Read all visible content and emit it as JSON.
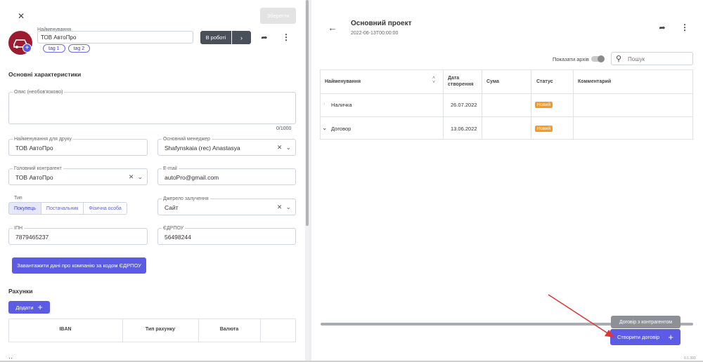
{
  "left": {
    "save_label": "Зберегти",
    "name_label": "Найменування",
    "name_value": "ТОВ АвтоПро",
    "status_label": "В роботі",
    "tags": [
      "tag 1",
      "tag 2"
    ],
    "section_main": "Основні характеристики",
    "desc_label": "Опис (необов'язково)",
    "desc_counter": "0/1000",
    "print_name_label": "Найменування для друку",
    "print_name_value": "ТОВ АвтоПро",
    "manager_label": "Основний менеджер",
    "manager_value": "Shafynskaia (rec) Anastasya",
    "counterparty_label": "Головний контрагент",
    "counterparty_value": "ТОВ АвтоПро",
    "email_label": "E-mail",
    "email_value": "autoPro@gmail.com",
    "type_label": "Тип",
    "type_options": [
      "Покупець",
      "Постачальник",
      "Фізична особа"
    ],
    "source_label": "Джерело залучення",
    "source_value": "Сайт",
    "ipn_label": "ІПН",
    "ipn_value": "7879465237",
    "edrpou_label": "ЄДРПОУ",
    "edrpou_value": "56498244",
    "load_button": "Завантажити дані про компанію за кодом ЄДРПОУ",
    "section_accounts": "Рахунки",
    "add_button": "Додати",
    "accounts_columns": [
      "IBAN",
      "Тип рахунку",
      "Валюта"
    ]
  },
  "right": {
    "title": "Основний проект",
    "subtitle": "2022-06-13T00:00:00",
    "show_archive_label": "Показати архів",
    "search_placeholder": "Пошук",
    "columns": [
      "Найменування",
      "Дата створення",
      "Сума",
      "Статус",
      "Комментарий"
    ],
    "rows": [
      {
        "name": "Наличка",
        "date": "26.07.2022",
        "sum": "",
        "status": "Новий",
        "comment": ""
      },
      {
        "name": "Договор",
        "date": "13.06.2022",
        "sum": "",
        "status": "Новий",
        "comment": ""
      }
    ],
    "tooltip": "Договір з контрагентом",
    "create_button": "Створити договір",
    "version": "0.1.393"
  },
  "colors": {
    "accent": "#5b5be6",
    "status_new": "#f59a23",
    "dark_button": "#4a505a",
    "avatar": "#9b1b2f"
  }
}
